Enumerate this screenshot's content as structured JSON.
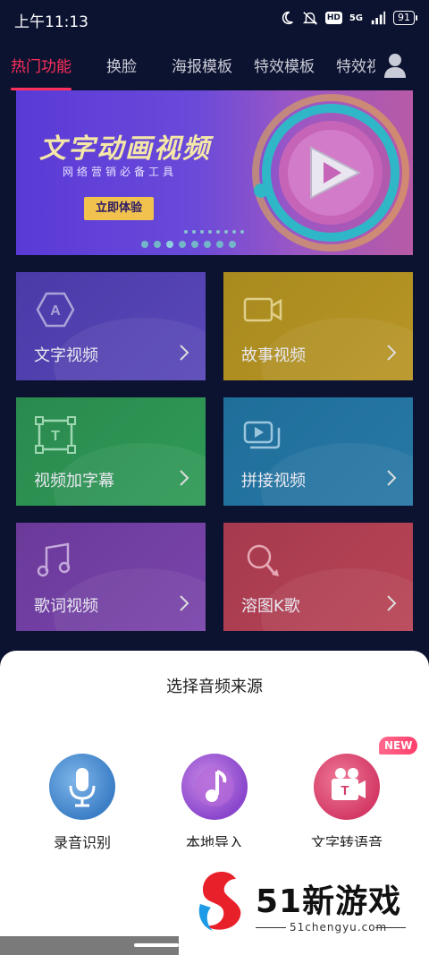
{
  "status_bar": {
    "time": "上午11:13",
    "network": "5G",
    "hd": "HD",
    "battery": "91"
  },
  "tabs": [
    {
      "label": "热门功能",
      "active": true
    },
    {
      "label": "换脸"
    },
    {
      "label": "海报模板"
    },
    {
      "label": "特效模板"
    },
    {
      "label": "特效视频"
    }
  ],
  "banner": {
    "title": "文字动画视频",
    "subtitle": "网络营销必备工具",
    "button": "立即体验"
  },
  "features": [
    {
      "label": "文字视频",
      "icon": "text-a-icon",
      "color": "#4a3aa8"
    },
    {
      "label": "故事视频",
      "icon": "camera-icon",
      "color": "#a88a1e"
    },
    {
      "label": "视频加字幕",
      "icon": "text-frame-icon",
      "color": "#2a8a4e"
    },
    {
      "label": "拼接视频",
      "icon": "stacked-video-icon",
      "color": "#1f6e9a"
    },
    {
      "label": "歌词视频",
      "icon": "music-note-icon",
      "color": "#6a3a9a"
    },
    {
      "label": "溶图K歌",
      "icon": "microphone-icon",
      "color": "#a63a4e"
    }
  ],
  "sheet": {
    "title": "选择音频来源",
    "options": [
      {
        "label": "录音识别",
        "icon": "microphone-icon"
      },
      {
        "label": "本地导入",
        "icon": "music-note-icon"
      },
      {
        "label": "文字转语音",
        "icon": "text-to-speech-icon",
        "badge": "NEW"
      }
    ]
  },
  "watermark": {
    "brand": "51新游戏",
    "site": "51chengyu.com"
  }
}
